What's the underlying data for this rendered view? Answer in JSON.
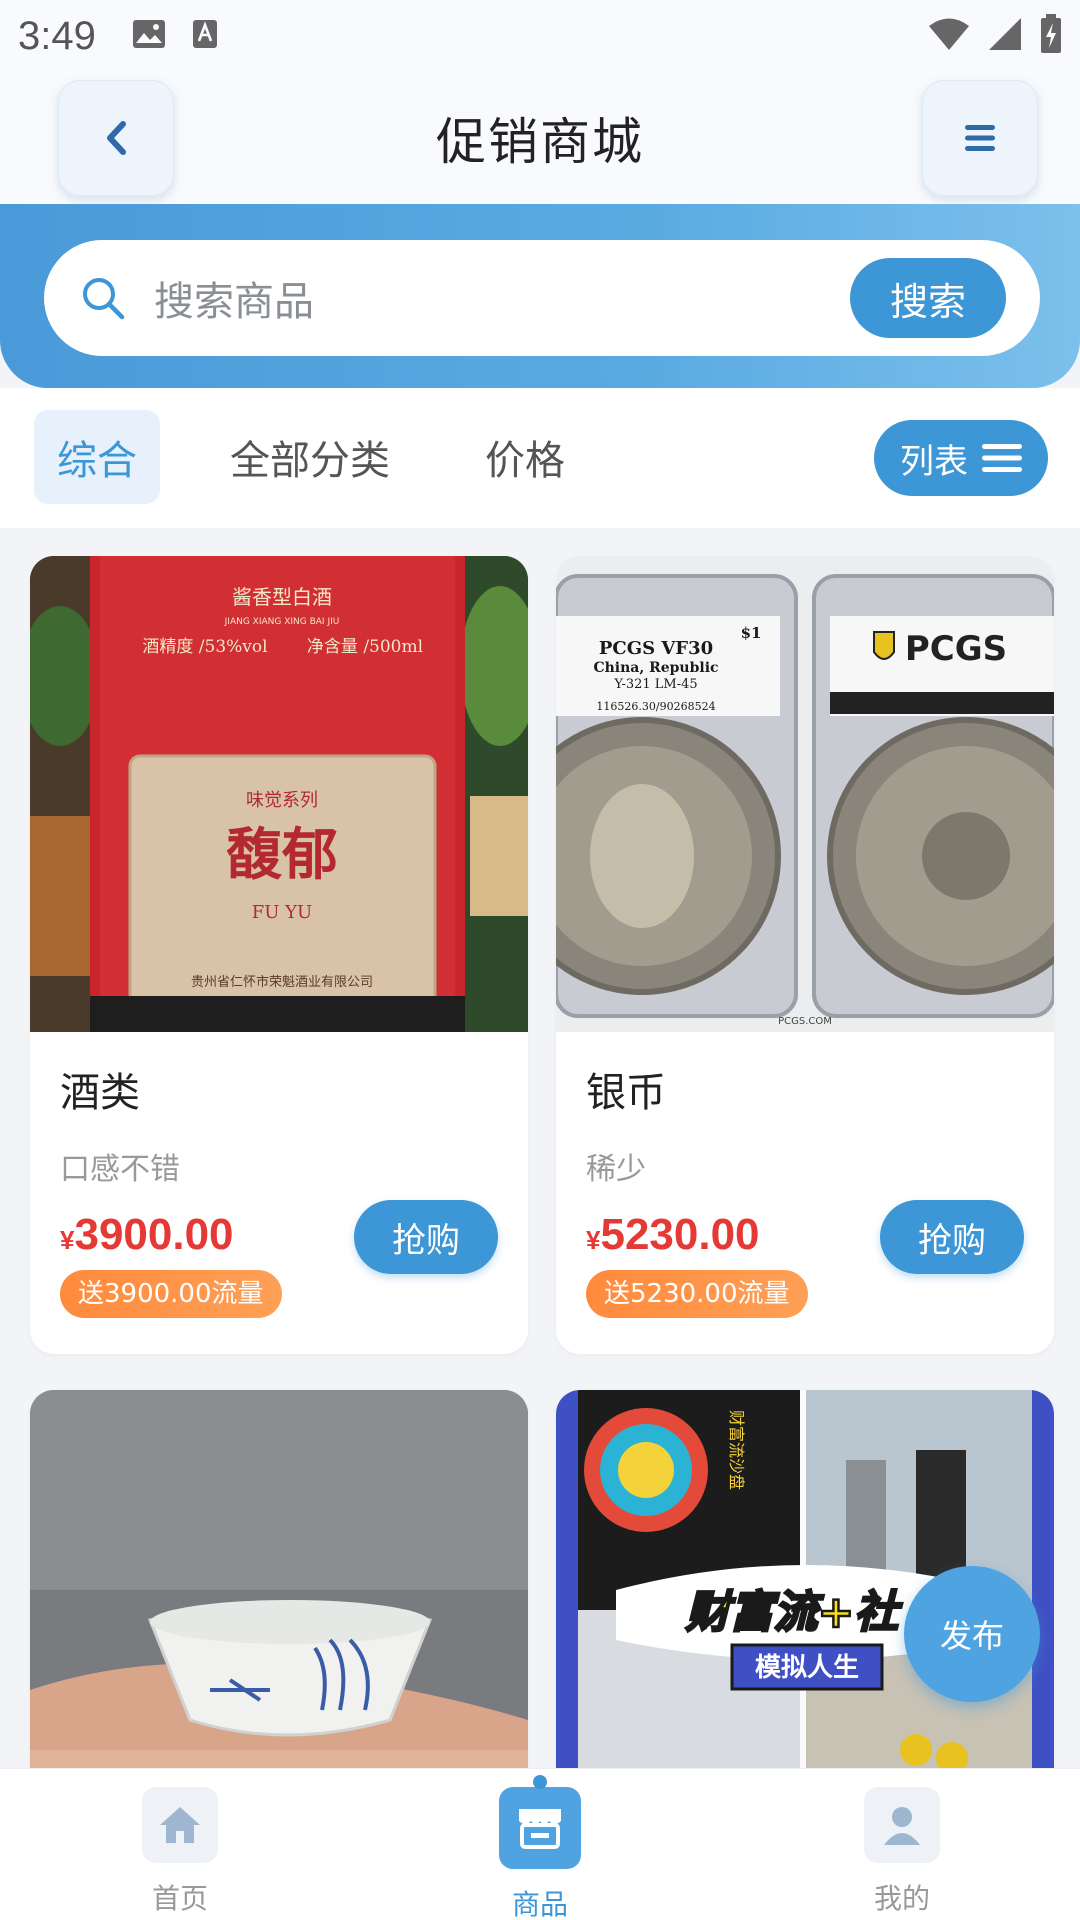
{
  "status_bar": {
    "time": "3:49"
  },
  "header": {
    "title": "促销商城"
  },
  "search": {
    "placeholder": "搜索商品",
    "button_label": "搜索"
  },
  "filters": {
    "tabs": [
      "综合",
      "全部分类",
      "价格"
    ],
    "active": "综合",
    "view_toggle_label": "列表"
  },
  "products": [
    {
      "title": "酒类",
      "subtitle": "口感不错",
      "currency": "¥",
      "price": "3900.00",
      "flow_badge": "送3900.00流量",
      "buy_label": "抢购",
      "image_text": {
        "line1": "酱香型白酒",
        "line2": "JIANG XIANG XING BAI JIU",
        "spec1": "酒精度 /53%vol",
        "spec2": "净含量 /500ml",
        "series": "味觉系列",
        "brand": "馥郁",
        "brand_py": "FU YU",
        "company": "贵州省仁怀市荣魁酒业有限公司"
      }
    },
    {
      "title": "银币",
      "subtitle": "稀少",
      "currency": "¥",
      "price": "5230.00",
      "flow_badge": "送5230.00流量",
      "buy_label": "抢购",
      "image_text": {
        "grade": "PCGS VF30",
        "country": "China, Republic",
        "code": "Y-321 LM-45",
        "cert": "116526.30/90268524",
        "denom": "$1",
        "logo": "PCGS",
        "site": "PCGS.COM"
      }
    },
    {
      "title": "",
      "subtitle": "",
      "image_text": {}
    },
    {
      "title": "",
      "subtitle": "",
      "image_text": {
        "banner": "财富流+社",
        "tag": "模拟人生",
        "side": "财富流沙盘"
      }
    }
  ],
  "publish_label": "发布",
  "bottom_nav": [
    {
      "label": "首页",
      "icon": "home-icon"
    },
    {
      "label": "商品",
      "icon": "store-icon",
      "active": true
    },
    {
      "label": "我的",
      "icon": "user-icon"
    }
  ],
  "colors": {
    "accent": "#3d96d6",
    "price": "#e53935",
    "badge": "#ff8a3d"
  }
}
